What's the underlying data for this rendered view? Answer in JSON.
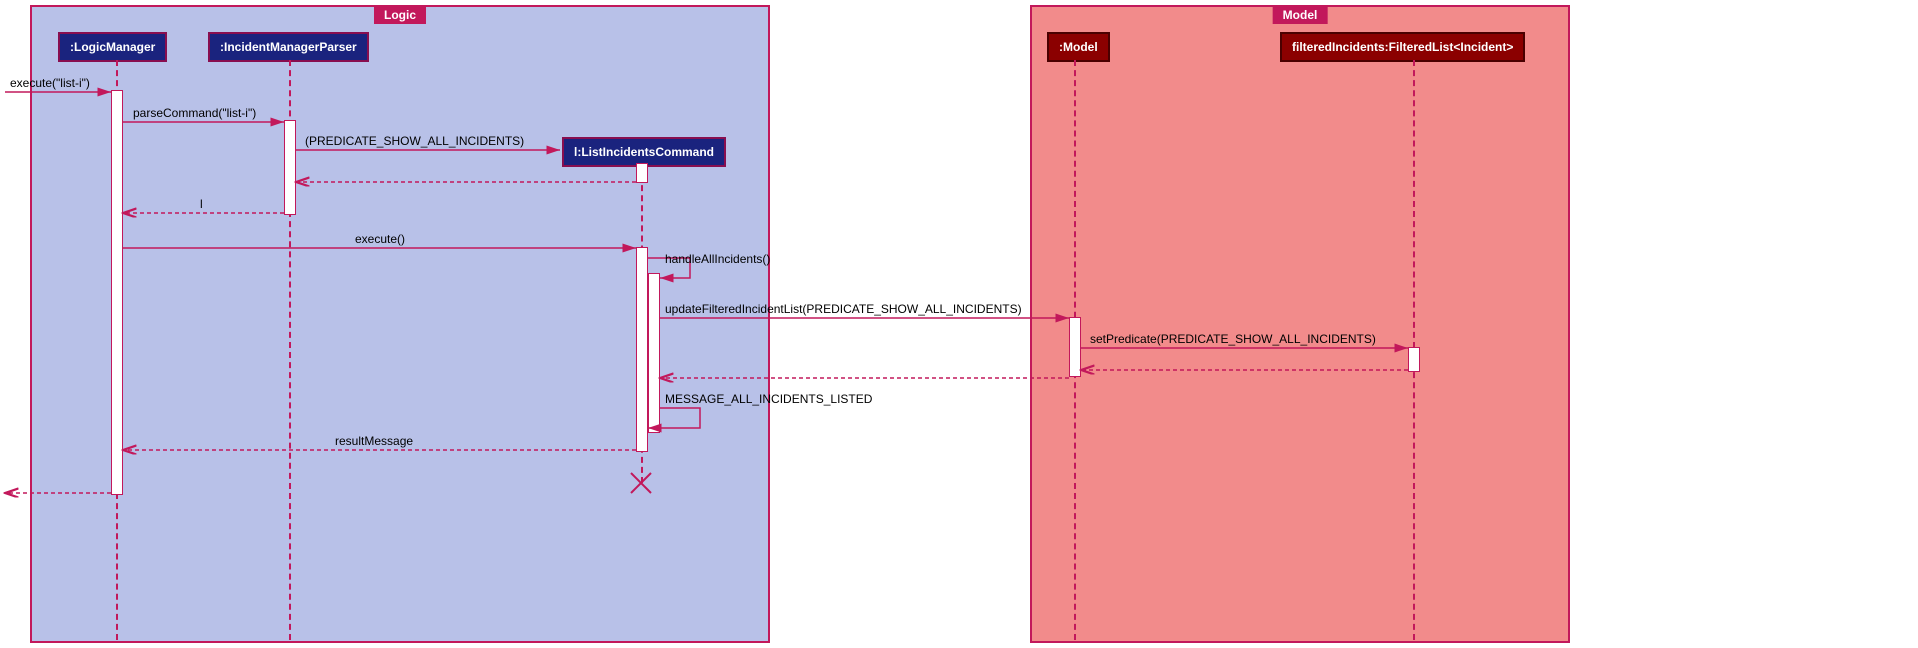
{
  "logic": {
    "title": "Logic",
    "participants": {
      "logicManager": ":LogicManager",
      "incidentManagerParser": ":IncidentManagerParser",
      "listIncidentsCommand": "l:ListIncidentsCommand"
    }
  },
  "model": {
    "title": "Model",
    "participants": {
      "model": ":Model",
      "filteredIncidents": "filteredIncidents:FilteredList<Incident>"
    }
  },
  "messages": {
    "execute_list_i": "execute(\"list-i\")",
    "parseCommand": "parseCommand(\"list-i\")",
    "predicate_create": "(PREDICATE_SHOW_ALL_INCIDENTS)",
    "return_l": "l",
    "execute_empty": "execute()",
    "handleAllIncidents": "handleAllIncidents()",
    "updateFilteredIncidentList": "updateFilteredIncidentList(PREDICATE_SHOW_ALL_INCIDENTS)",
    "setPredicate": "setPredicate(PREDICATE_SHOW_ALL_INCIDENTS)",
    "message_all": "MESSAGE_ALL_INCIDENTS_LISTED",
    "resultMessage": "resultMessage"
  },
  "colors": {
    "logic_bg": "#b8c1e8",
    "logic_border": "#c2185b",
    "logic_participant_bg": "#1a237e",
    "logic_participant_border": "#880e4f",
    "logic_participant_text": "#fff",
    "model_bg": "#f28b8b",
    "model_border": "#c2185b",
    "model_participant_bg": "#8b0000",
    "model_participant_border": "#4a0000",
    "model_participant_text": "#fff",
    "arrow": "#c2185b"
  }
}
